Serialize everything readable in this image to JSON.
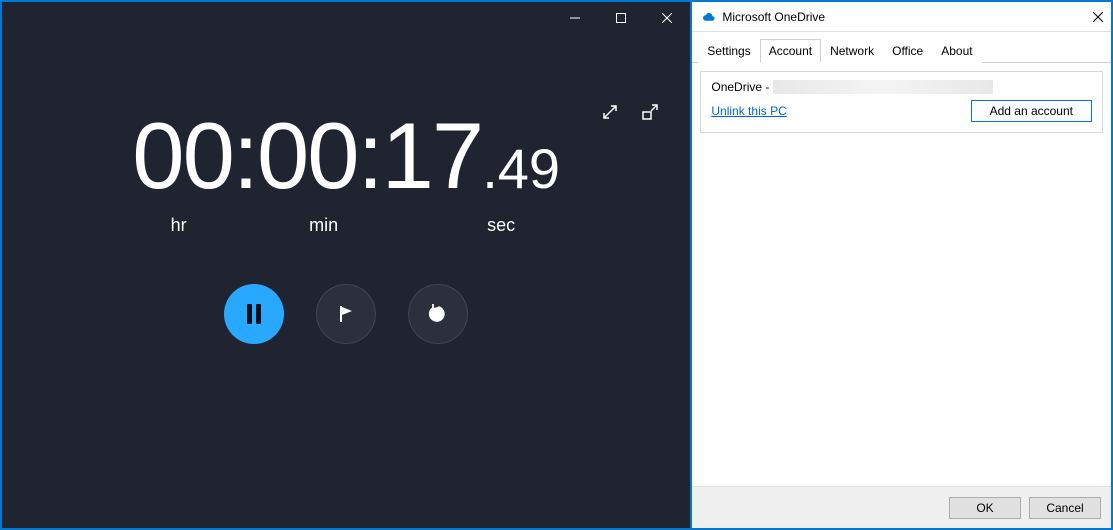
{
  "stopwatch": {
    "time_main": "00:00:17",
    "time_frac": ".49",
    "labels": {
      "hr": "hr",
      "min": "min",
      "sec": "sec"
    }
  },
  "onedrive": {
    "title": "Microsoft OneDrive",
    "tabs": {
      "settings": "Settings",
      "account": "Account",
      "network": "Network",
      "office": "Office",
      "about": "About"
    },
    "account_label": "OneDrive -",
    "unlink_label": "Unlink this PC",
    "add_account_label": "Add an account",
    "ok_label": "OK",
    "cancel_label": "Cancel"
  }
}
